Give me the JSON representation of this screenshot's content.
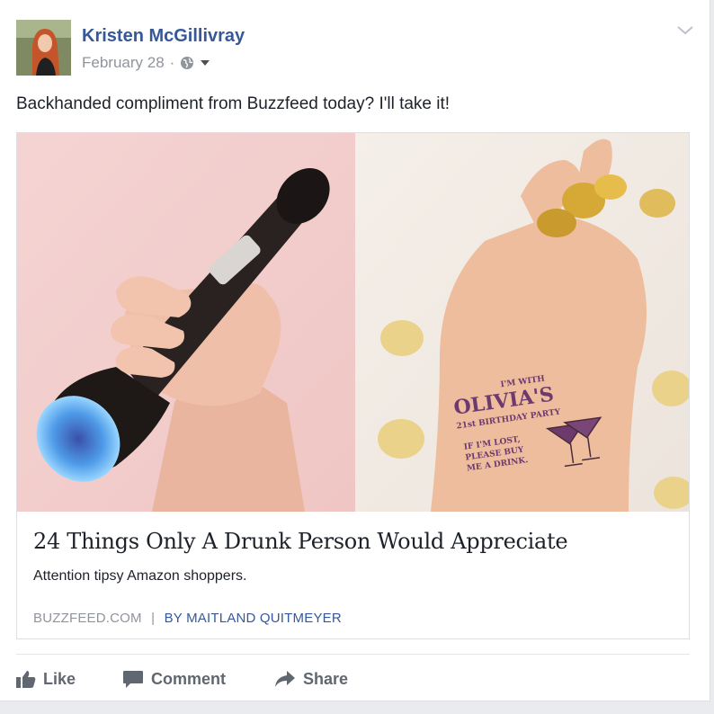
{
  "post": {
    "author": "Kristen McGillivray",
    "date": "February 28",
    "separator": "·",
    "privacy_icon": "globe-icon",
    "text": "Backhanded compliment from Buzzfeed today? I'll take it!"
  },
  "link": {
    "title": "24 Things Only A Drunk Person Would Appreciate",
    "description": "Attention tipsy Amazon shoppers.",
    "domain": "BUZZFEED.COM",
    "divider": "|",
    "byline": "BY MAITLAND QUITMEYER",
    "tattoo": {
      "line1": "I'M WITH",
      "line2": "OLIVIA'S",
      "line3": "21st BIRTHDAY PARTY",
      "line4": "IF I'M LOST,",
      "line5": "PLEASE BUY",
      "line6": "ME A DRINK."
    }
  },
  "actions": {
    "like": "Like",
    "comment": "Comment",
    "share": "Share"
  },
  "colors": {
    "link_blue": "#365899",
    "meta_gray": "#90949c",
    "action_gray": "#606770",
    "tattoo_purple": "#6e3a6e"
  }
}
